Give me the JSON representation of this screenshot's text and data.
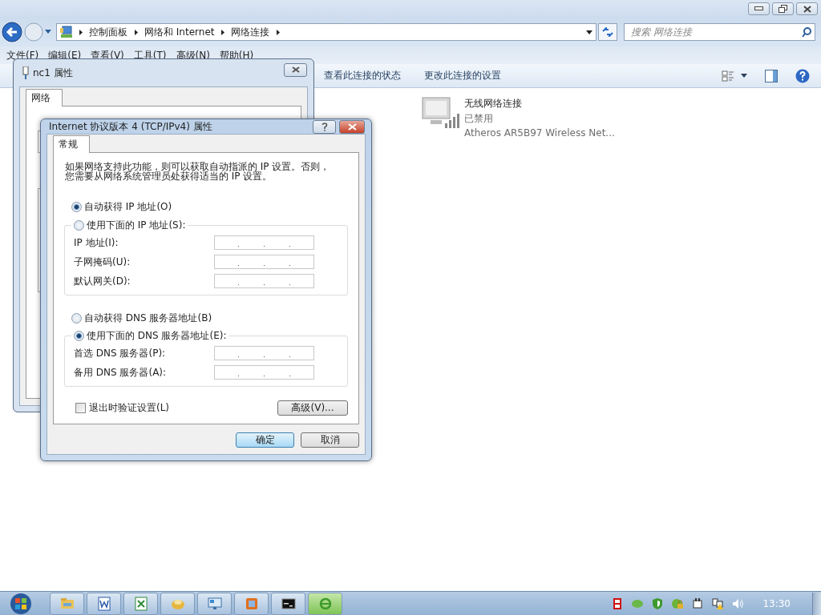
{
  "address_bar": {
    "breadcrumbs": [
      "控制面板",
      "网络和 Internet",
      "网络连接"
    ]
  },
  "search": {
    "placeholder": "搜索 网络连接"
  },
  "menu": [
    "文件(F)",
    "编辑(E)",
    "查看(V)",
    "工具(T)",
    "高级(N)",
    "帮助(H)"
  ],
  "command_bar": [
    "查看此连接的状态",
    "更改此连接的设置"
  ],
  "connections": [
    {
      "name": "无线网络连接",
      "status": "已禁用",
      "device": "Atheros AR5B97 Wireless Net..."
    }
  ],
  "back_dialog": {
    "title": "nc1 属性",
    "tabs": [
      {
        "label": "网络",
        "selected": true
      }
    ]
  },
  "dialog": {
    "title": "Internet 协议版本 4 (TCP/IPv4) 属性",
    "tabs": [
      {
        "label": "常规",
        "selected": true
      }
    ],
    "description": [
      "如果网络支持此功能，则可以获取自动指派的 IP 设置。否则，",
      "您需要从网络系统管理员处获得适当的 IP 设置。"
    ],
    "ip_options": [
      {
        "label": "自动获得 IP 地址(O)",
        "selected": true
      },
      {
        "label": "使用下面的 IP 地址(S):",
        "selected": false
      }
    ],
    "ip_fields": [
      {
        "label": "IP 地址(I):"
      },
      {
        "label": "子网掩码(U):"
      },
      {
        "label": "默认网关(D):"
      }
    ],
    "dns_options": [
      {
        "label": "自动获得 DNS 服务器地址(B)",
        "selected": false
      },
      {
        "label": "使用下面的 DNS 服务器地址(E):",
        "selected": true
      }
    ],
    "dns_fields": [
      {
        "label": "首选 DNS 服务器(P):"
      },
      {
        "label": "备用 DNS 服务器(A):"
      }
    ],
    "validate_on_exit": {
      "label": "退出时验证设置(L)",
      "checked": false
    },
    "advanced_button": "高级(V)...",
    "buttons": [
      {
        "label": "确定",
        "default": true
      },
      {
        "label": "取消",
        "default": false
      }
    ]
  },
  "taskbar": {
    "clock": "13:30"
  }
}
